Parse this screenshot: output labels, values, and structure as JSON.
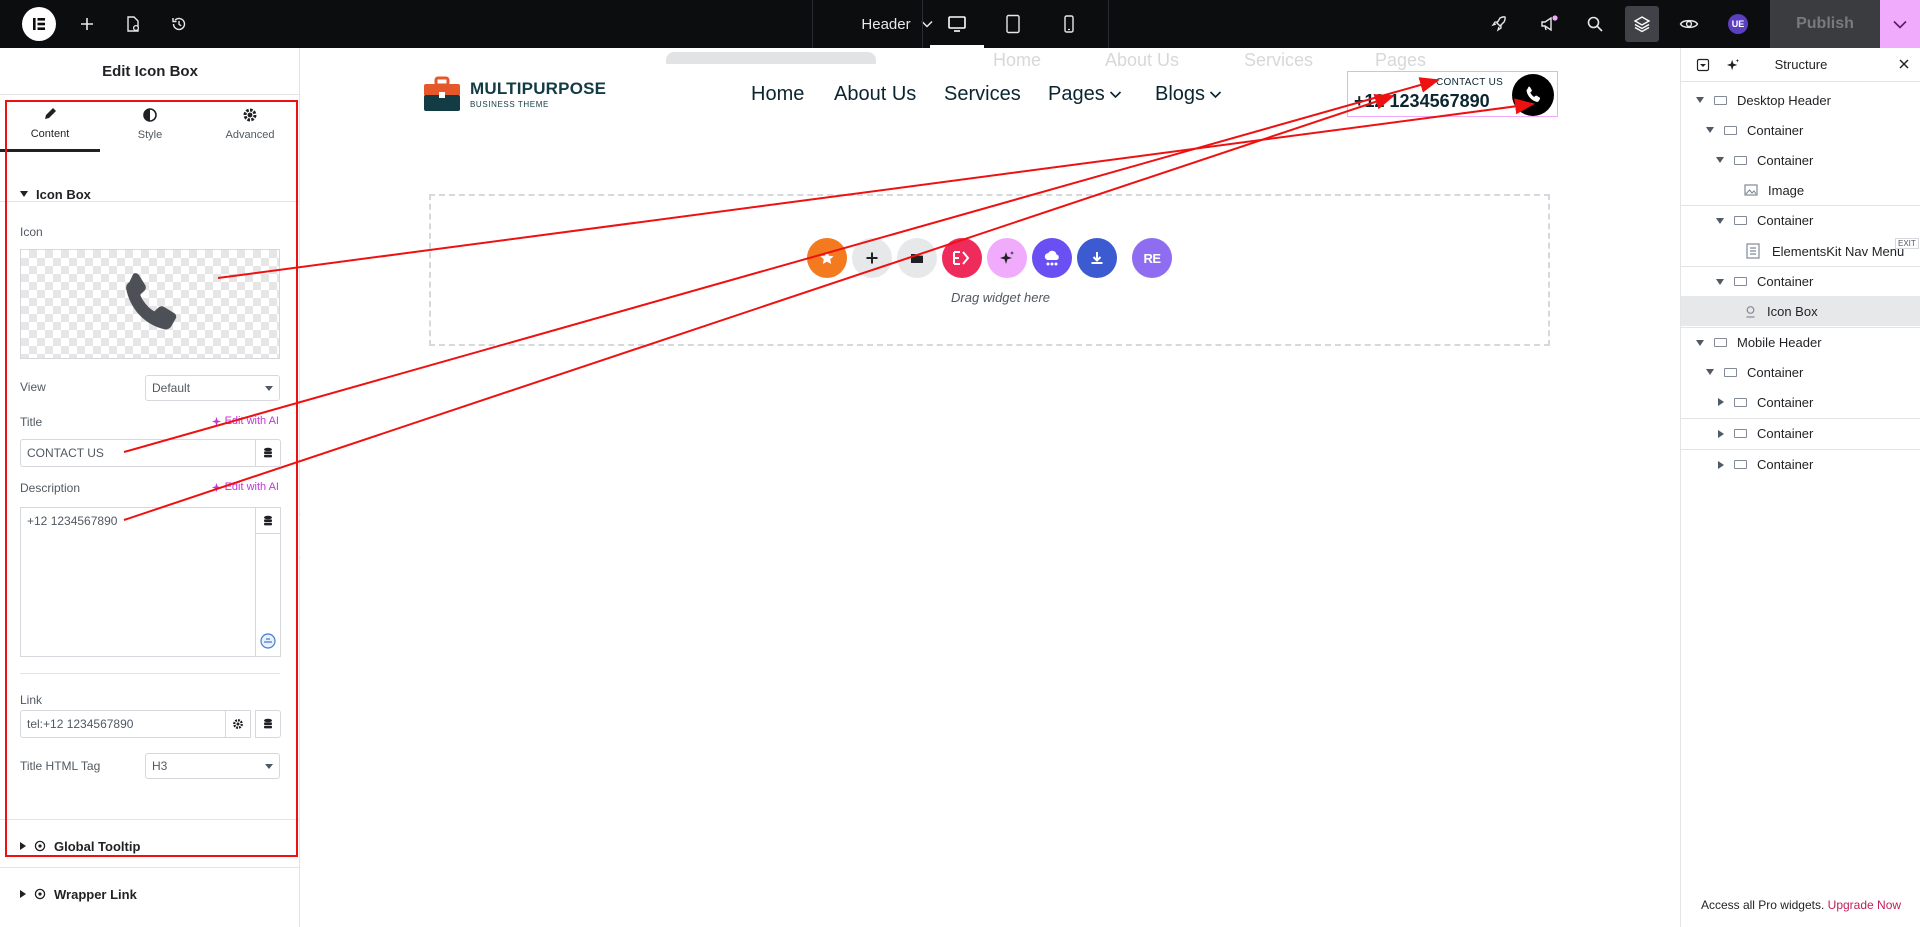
{
  "topbar": {
    "document_title": "Header",
    "publish_label": "Publish",
    "avatar_initials": "UE"
  },
  "panel": {
    "title": "Edit Icon Box",
    "tabs": [
      {
        "label": "Content",
        "icon": "pencil-icon"
      },
      {
        "label": "Style",
        "icon": "half-circle-icon"
      },
      {
        "label": "Advanced",
        "icon": "gear-icon"
      }
    ],
    "section_title": "Icon Box",
    "icon_label": "Icon",
    "icon_preview": "phone-icon",
    "view_label": "View",
    "view_value": "Default",
    "title_label": "Title",
    "title_value": "CONTACT US",
    "edit_ai": "Edit with AI",
    "description_label": "Description",
    "description_value": "+12 1234567890",
    "link_label": "Link",
    "link_value": "tel:+12 1234567890",
    "html_tag_label": "Title HTML Tag",
    "html_tag_value": "H3",
    "global_tooltip": "Global Tooltip",
    "wrapper_link": "Wrapper Link"
  },
  "canvas": {
    "ghost_nav": [
      "Home",
      "About Us",
      "Services",
      "Pages"
    ],
    "logo_name": "MULTIPURPOSE",
    "logo_sub": "BUSINESS THEME",
    "nav": [
      {
        "label": "Home",
        "dropdown": false
      },
      {
        "label": "About Us",
        "dropdown": false
      },
      {
        "label": "Services",
        "dropdown": false
      },
      {
        "label": "Pages",
        "dropdown": true
      },
      {
        "label": "Blogs",
        "dropdown": true
      }
    ],
    "contact_title": "CONTACT US",
    "contact_phone": "+12 1234567890",
    "drag_text": "Drag widget here",
    "dropzone_buttons": [
      {
        "name": "favorite-star-button",
        "color": "#f47a20"
      },
      {
        "name": "add-section-button",
        "color": "#e6e8ea"
      },
      {
        "name": "template-folder-button",
        "color": "#e6e8ea"
      },
      {
        "name": "elementskit-button",
        "color": "#ef2b5c"
      },
      {
        "name": "ai-sparkle-button",
        "color": "#f0abfc"
      },
      {
        "name": "cloud-library-button",
        "color": "#6a4ff2"
      },
      {
        "name": "download-button",
        "color": "#3d5bd0"
      },
      {
        "name": "royal-elements-button",
        "color": "#8f6df0"
      }
    ],
    "dropzone_re_label": "RE"
  },
  "structure": {
    "title": "Structure",
    "items": [
      {
        "label": "Desktop Header",
        "level": 0,
        "toggle": "open",
        "type": "container"
      },
      {
        "label": "Container",
        "level": 1,
        "toggle": "open",
        "type": "container"
      },
      {
        "label": "Container",
        "level": 2,
        "toggle": "open",
        "type": "container"
      },
      {
        "label": "Image",
        "level": 3,
        "toggle": "none",
        "type": "image"
      },
      {
        "label": "Container",
        "level": 2,
        "toggle": "open",
        "type": "container"
      },
      {
        "label": "ElementsKit Nav Menu",
        "level": 3,
        "toggle": "none",
        "type": "menu"
      },
      {
        "label": "Container",
        "level": 2,
        "toggle": "open",
        "type": "container"
      },
      {
        "label": "Icon Box",
        "level": 3,
        "toggle": "none",
        "type": "iconbox",
        "selected": true
      },
      {
        "label": "Mobile Header",
        "level": 0,
        "toggle": "open",
        "type": "container"
      },
      {
        "label": "Container",
        "level": 1,
        "toggle": "open",
        "type": "container"
      },
      {
        "label": "Container",
        "level": 2,
        "toggle": "closed",
        "type": "container"
      },
      {
        "label": "Container",
        "level": 2,
        "toggle": "closed",
        "type": "container"
      },
      {
        "label": "Container",
        "level": 2,
        "toggle": "closed",
        "type": "container"
      }
    ],
    "exit_badge": "EXIT",
    "footer_text": "Access all Pro widgets.",
    "footer_link": "Upgrade Now"
  },
  "colors": {
    "topbar": "#0c0d0e",
    "accent_pink": "#f0abfc",
    "ai_purple": "#c036d8",
    "annotation_red": "#ee1111"
  }
}
